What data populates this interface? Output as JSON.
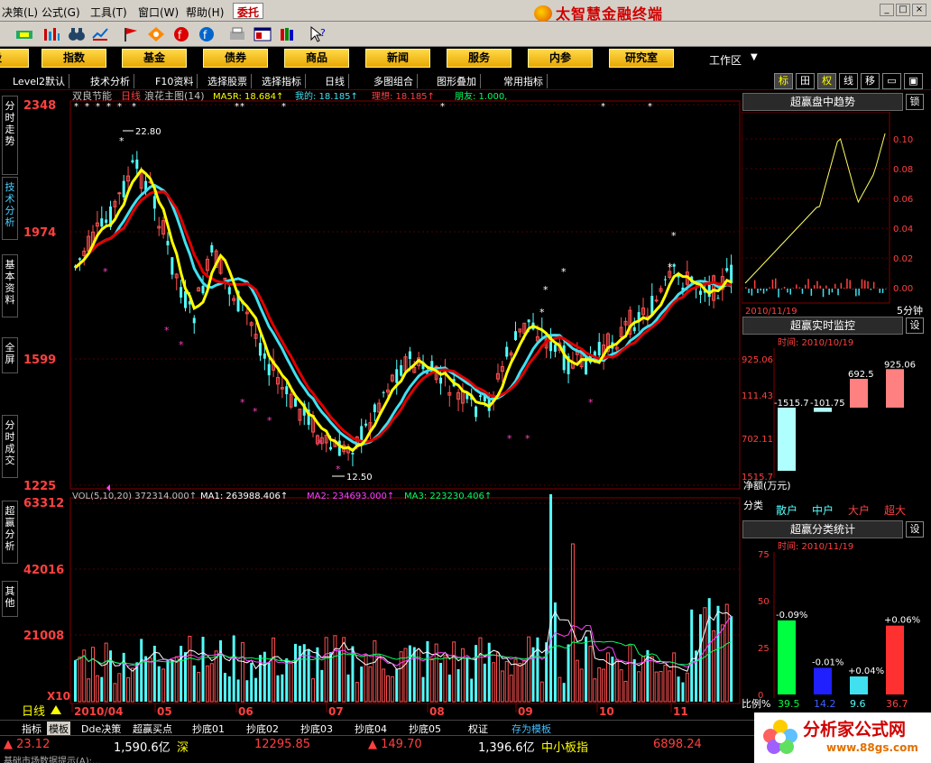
{
  "menu": {
    "items": [
      "决策(L)",
      "公式(G)",
      "工具(T)",
      "窗口(W)",
      "帮助(H)"
    ],
    "weituo": "委托",
    "brand": "太智慧金融终端"
  },
  "nav": {
    "buttons": [
      "股",
      "指数",
      "基金",
      "债券",
      "商品",
      "新闻",
      "服务",
      "内参",
      "研究室"
    ],
    "workarea": "工作区"
  },
  "subbar": {
    "items": [
      "Level2默认",
      "技术分析",
      "F10资料",
      "选择股票",
      "选择指标",
      "日线",
      "多图组合",
      "图形叠加",
      "常用指标"
    ],
    "right": [
      "标",
      "田",
      "权",
      "线",
      "移"
    ]
  },
  "lefttabs": [
    "分时走势",
    "技术分析",
    "基本资料",
    "全屏",
    "分时成交",
    "超赢分析",
    "其他"
  ],
  "chart": {
    "y_labels": [
      "2348",
      "1974",
      "1599",
      "1225"
    ],
    "header_name": "双良节能",
    "header_period": "日线",
    "header_main": "浪花主图(14)",
    "ma5r": "MA5R: 18.684↑",
    "wode": "我的: 18.185↑",
    "lixiang": "理想: 18.185↑",
    "pengyou": "朋友: 1.000,",
    "hi_label": "22.80",
    "lo_label": "12.50",
    "vol_y_labels": [
      "63312",
      "42016",
      "21008",
      "X10"
    ],
    "vol_header": "VOL(5,10,20) 372314.000↑",
    "vol_ma1": "MA1: 263988.406↑",
    "vol_ma2": "MA2: 234693.000↑",
    "vol_ma3": "MA3: 223230.406↑",
    "x_labels": [
      "2010/04",
      "05",
      "06",
      "07",
      "08",
      "09",
      "10",
      "11"
    ],
    "period_label": "日线",
    "colors": {
      "up": "#ff5050",
      "down": "#54fcfc",
      "ma_yellow": "#ffff00",
      "ma_red": "#e00000",
      "ma_cyan": "#40e0f0"
    }
  },
  "right": {
    "trend_title": "超赢盘中趋势",
    "lock": "锁",
    "trend_ticks": [
      "0.10",
      "0.08",
      "0.06",
      "0.04",
      "0.02",
      "0.00"
    ],
    "trend_date": "2010/11/19",
    "trend_period": "5分钟",
    "monitor_title": "超赢实时监控",
    "settings": "设",
    "monitor_time": "时间: 2010/10/19",
    "monitor_y": [
      "925.06",
      "111.43",
      "702.11",
      "1515.7"
    ],
    "monitor_values": [
      "-1515.7",
      "-101.75",
      "692.5",
      "925.06"
    ],
    "net_label": "净额(万元)",
    "class_label": "分类",
    "categories": [
      "散户",
      "中户",
      "大户",
      "超大"
    ],
    "stats_title": "超赢分类统计",
    "stats_time": "时间: 2010/11/19",
    "stats_y": [
      "75",
      "50",
      "25",
      "0"
    ],
    "stats_pct": [
      "-0.09%",
      "-0.01%",
      "+0.04%",
      "+0.06%"
    ],
    "ratio_label": "比例%",
    "ratio_values": [
      "39.5",
      "14.2",
      "9.6",
      "36.7"
    ]
  },
  "bottomtabs": [
    "指标",
    "模板",
    "Dde决策",
    "超赢买点",
    "抄底01",
    "抄底02",
    "抄底03",
    "抄底04",
    "抄底05",
    "权证",
    "存为模板"
  ],
  "status": {
    "s1": "▲ 23.12",
    "s2": "1,590.6亿",
    "s3": "深",
    "s4": "12295.85",
    "s5": "▲ 149.70",
    "s6": "1,396.6亿",
    "s7": "中小板指",
    "s8": "6898.24",
    "line": "基础市场数据提示(A):..."
  },
  "watermark": {
    "main": "分析家公式网",
    "url": "www.88gs.com"
  }
}
